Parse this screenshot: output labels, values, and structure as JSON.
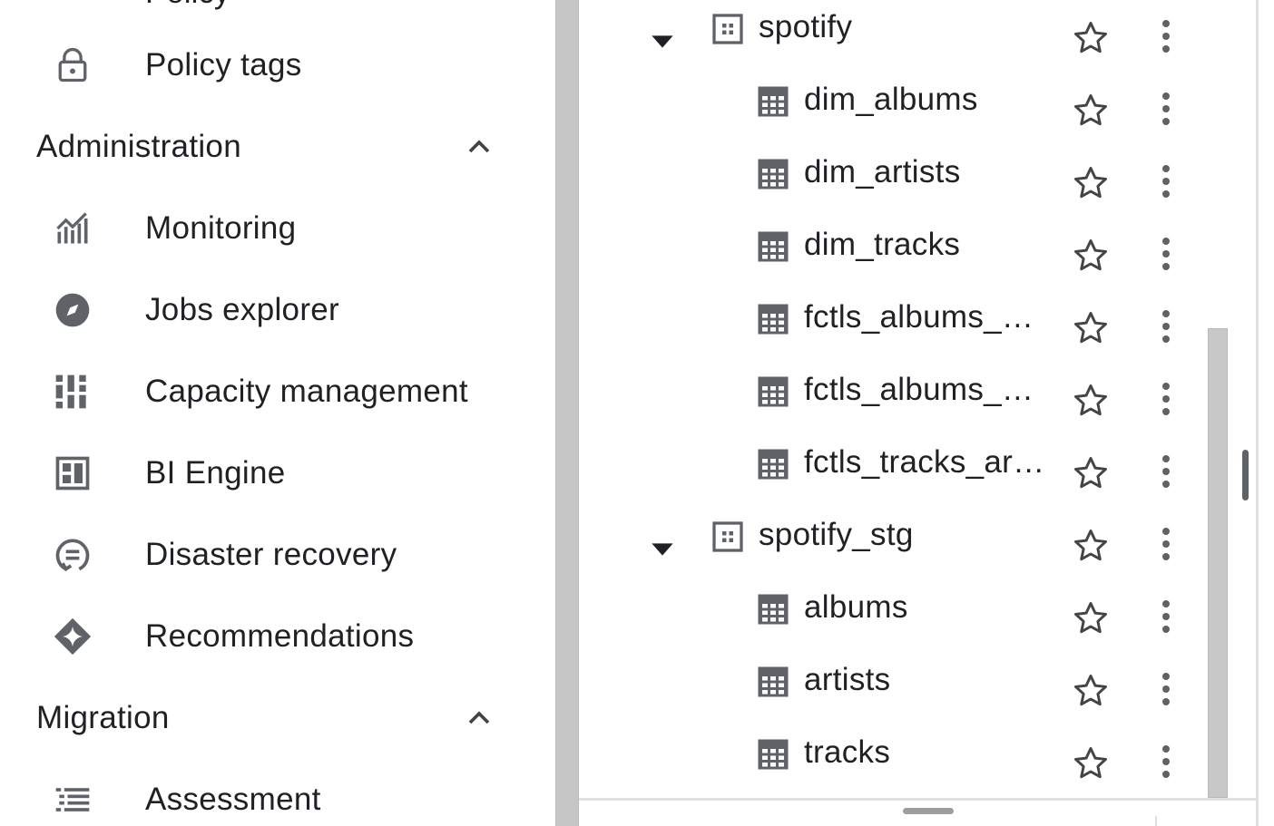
{
  "nav": {
    "partial_top_label": "Policy",
    "items_top": [
      {
        "label": "Policy tags",
        "icon": "lock-icon"
      }
    ],
    "sections": [
      {
        "title": "Administration",
        "expanded": true,
        "items": [
          {
            "label": "Monitoring",
            "icon": "monitoring-chart-icon"
          },
          {
            "label": "Jobs explorer",
            "icon": "compass-icon"
          },
          {
            "label": "Capacity management",
            "icon": "capacity-bars-icon"
          },
          {
            "label": "BI Engine",
            "icon": "bi-engine-icon"
          },
          {
            "label": "Disaster recovery",
            "icon": "disaster-recovery-icon"
          },
          {
            "label": "Recommendations",
            "icon": "sparkle-diamond-icon"
          }
        ]
      },
      {
        "title": "Migration",
        "expanded": true,
        "items": [
          {
            "label": "Assessment",
            "icon": "list-checks-icon"
          }
        ]
      }
    ]
  },
  "explorer": {
    "datasets": [
      {
        "name": "spotify",
        "expanded": true,
        "tables": [
          "dim_albums",
          "dim_artists",
          "dim_tracks",
          "fctls_albums_…",
          "fctls_albums_…",
          "fctls_tracks_ar…"
        ]
      },
      {
        "name": "spotify_stg",
        "expanded": true,
        "tables": [
          "albums",
          "artists",
          "tracks"
        ]
      }
    ]
  },
  "colors": {
    "icon_gray": "#5f6368",
    "text": "#202124",
    "divider": "#c6c6c6"
  }
}
